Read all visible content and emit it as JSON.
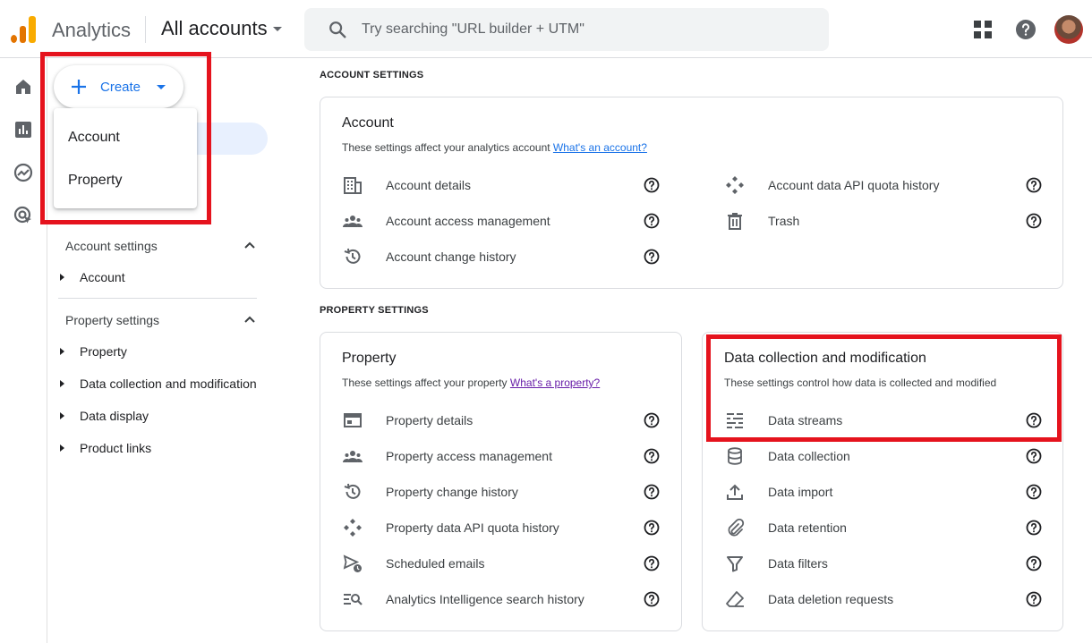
{
  "header": {
    "app_name": "Analytics",
    "account_switcher": "All accounts",
    "search_placeholder": "Try searching \"URL builder + UTM\""
  },
  "create_menu": {
    "button_label": "Create",
    "items": [
      "Account",
      "Property"
    ]
  },
  "nav": {
    "account_settings": {
      "label": "Account settings",
      "items": [
        "Account"
      ]
    },
    "property_settings": {
      "label": "Property settings",
      "items": [
        "Property",
        "Data collection and modification",
        "Data display",
        "Product links"
      ]
    }
  },
  "main": {
    "account_settings_heading": "ACCOUNT SETTINGS",
    "property_settings_heading": "PROPERTY SETTINGS",
    "account_card": {
      "title": "Account",
      "subtitle": "These settings affect your analytics account",
      "link": "What's an account?",
      "left_items": [
        "Account details",
        "Account access management",
        "Account change history"
      ],
      "right_items": [
        "Account data API quota history",
        "Trash"
      ]
    },
    "property_card": {
      "title": "Property",
      "subtitle": "These settings affect your property",
      "link": "What's a property?",
      "items": [
        "Property details",
        "Property access management",
        "Property change history",
        "Property data API quota history",
        "Scheduled emails",
        "Analytics Intelligence search history"
      ]
    },
    "data_card": {
      "title": "Data collection and modification",
      "subtitle": "These settings control how data is collected and modified",
      "items": [
        "Data streams",
        "Data collection",
        "Data import",
        "Data retention",
        "Data filters",
        "Data deletion requests"
      ]
    }
  },
  "colors": {
    "accent": "#1a73e8",
    "highlight_box": "#e5131d",
    "logo_orange": "#e37400",
    "logo_yellow": "#f9ab00"
  }
}
